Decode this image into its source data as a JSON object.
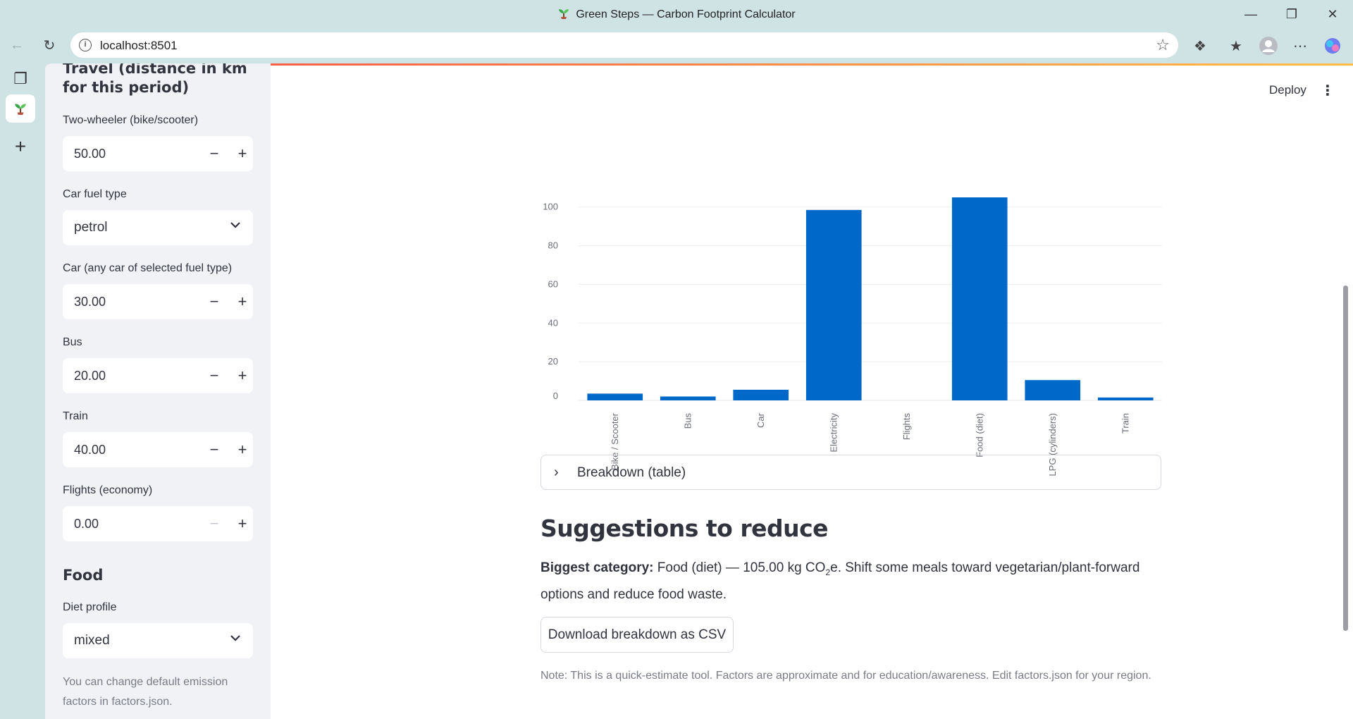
{
  "browser": {
    "window_title": "Green Steps — Carbon Footprint Calculator",
    "url": "localhost:8501"
  },
  "sidebar": {
    "travel_heading": "Travel (distance in km for this period)",
    "inputs": [
      {
        "label": "Two-wheeler (bike/scooter)",
        "value": "50.00"
      },
      {
        "label": "Car (any car of selected fuel type)",
        "value": "30.00"
      },
      {
        "label": "Bus",
        "value": "20.00"
      },
      {
        "label": "Train",
        "value": "40.00"
      },
      {
        "label": "Flights (economy)",
        "value": "0.00"
      }
    ],
    "car_fuel": {
      "label": "Car fuel type",
      "value": "petrol"
    },
    "food_heading": "Food",
    "diet": {
      "label": "Diet profile",
      "value": "mixed"
    },
    "note": "You can change default emission factors in factors.json."
  },
  "header": {
    "deploy_label": "Deploy"
  },
  "chart_data": {
    "type": "bar",
    "categories": [
      "Bike / Scooter",
      "Bus",
      "Car",
      "Electricity",
      "Flights",
      "Food (diet)",
      "LPG (cylinders)",
      "Train"
    ],
    "values": [
      3.5,
      2.0,
      5.5,
      98.5,
      0,
      105.0,
      10.5,
      1.5
    ],
    "yticks": [
      0,
      20,
      40,
      60,
      80,
      100
    ],
    "ylim": [
      0,
      105
    ],
    "color": "#0068c9",
    "grid": true
  },
  "breakdown": {
    "label": "Breakdown (table)"
  },
  "suggestions": {
    "heading": "Suggestions to reduce",
    "lead": "Biggest category:",
    "text_pre": "Food (diet) — 105.00 kg CO",
    "text_sub": "2",
    "text_post": "e. Shift some meals toward vegetarian/plant-forward options and reduce food waste."
  },
  "download_label": "Download breakdown as CSV",
  "footnote": "Note: This is a quick-estimate tool. Factors are approximate and for education/awareness. Edit factors.json for your region."
}
